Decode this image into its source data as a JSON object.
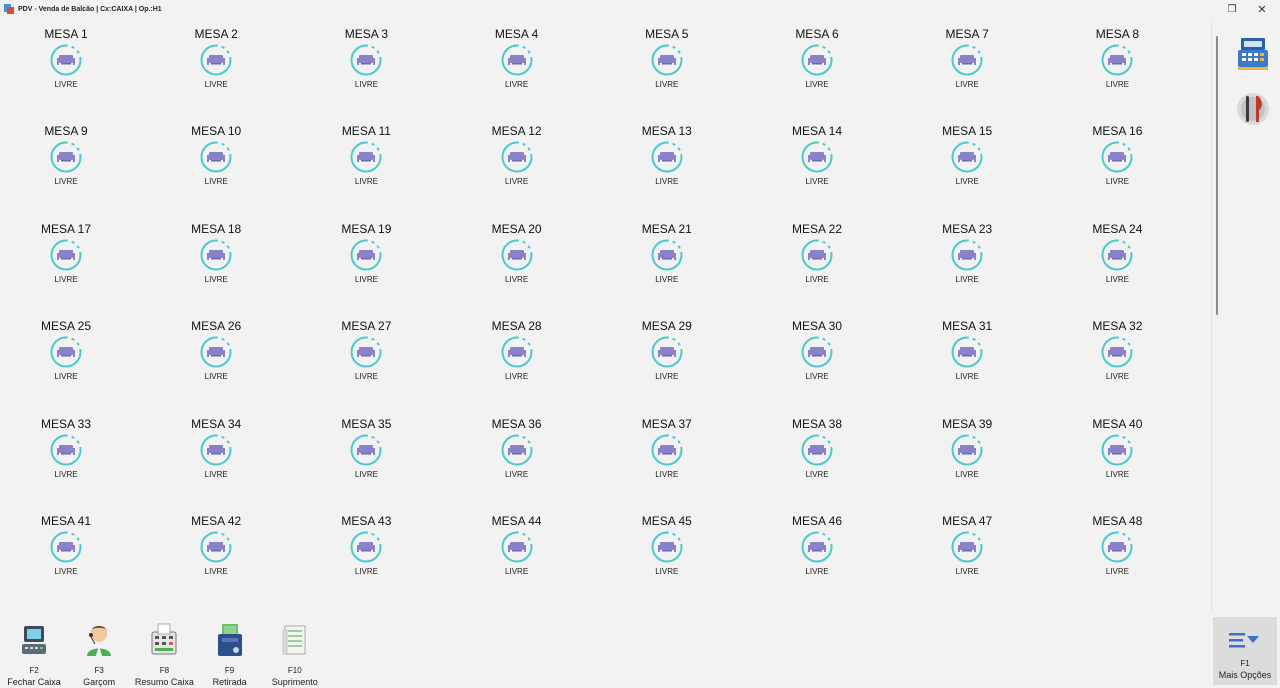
{
  "window": {
    "title": "PDV - Venda de Balcão | Cx:CAIXA | Op.:H1",
    "restore_glyph": "❐",
    "close_glyph": "✕"
  },
  "tables": [
    {
      "name": "MESA 1",
      "status": "LIVRE"
    },
    {
      "name": "MESA 2",
      "status": "LIVRE"
    },
    {
      "name": "MESA 3",
      "status": "LIVRE"
    },
    {
      "name": "MESA 4",
      "status": "LIVRE"
    },
    {
      "name": "MESA 5",
      "status": "LIVRE"
    },
    {
      "name": "MESA 6",
      "status": "LIVRE"
    },
    {
      "name": "MESA 7",
      "status": "LIVRE"
    },
    {
      "name": "MESA 8",
      "status": "LIVRE"
    },
    {
      "name": "MESA 9",
      "status": "LIVRE"
    },
    {
      "name": "MESA 10",
      "status": "LIVRE"
    },
    {
      "name": "MESA 11",
      "status": "LIVRE"
    },
    {
      "name": "MESA 12",
      "status": "LIVRE"
    },
    {
      "name": "MESA 13",
      "status": "LIVRE"
    },
    {
      "name": "MESA 14",
      "status": "LIVRE"
    },
    {
      "name": "MESA 15",
      "status": "LIVRE"
    },
    {
      "name": "MESA 16",
      "status": "LIVRE"
    },
    {
      "name": "MESA 17",
      "status": "LIVRE"
    },
    {
      "name": "MESA 18",
      "status": "LIVRE"
    },
    {
      "name": "MESA 19",
      "status": "LIVRE"
    },
    {
      "name": "MESA 20",
      "status": "LIVRE"
    },
    {
      "name": "MESA 21",
      "status": "LIVRE"
    },
    {
      "name": "MESA 22",
      "status": "LIVRE"
    },
    {
      "name": "MESA 23",
      "status": "LIVRE"
    },
    {
      "name": "MESA 24",
      "status": "LIVRE"
    },
    {
      "name": "MESA 25",
      "status": "LIVRE"
    },
    {
      "name": "MESA 26",
      "status": "LIVRE"
    },
    {
      "name": "MESA 27",
      "status": "LIVRE"
    },
    {
      "name": "MESA 28",
      "status": "LIVRE"
    },
    {
      "name": "MESA 29",
      "status": "LIVRE"
    },
    {
      "name": "MESA 30",
      "status": "LIVRE"
    },
    {
      "name": "MESA 31",
      "status": "LIVRE"
    },
    {
      "name": "MESA 32",
      "status": "LIVRE"
    },
    {
      "name": "MESA 33",
      "status": "LIVRE"
    },
    {
      "name": "MESA 34",
      "status": "LIVRE"
    },
    {
      "name": "MESA 35",
      "status": "LIVRE"
    },
    {
      "name": "MESA 36",
      "status": "LIVRE"
    },
    {
      "name": "MESA 37",
      "status": "LIVRE"
    },
    {
      "name": "MESA 38",
      "status": "LIVRE"
    },
    {
      "name": "MESA 39",
      "status": "LIVRE"
    },
    {
      "name": "MESA 40",
      "status": "LIVRE"
    },
    {
      "name": "MESA 41",
      "status": "LIVRE"
    },
    {
      "name": "MESA 42",
      "status": "LIVRE"
    },
    {
      "name": "MESA 43",
      "status": "LIVRE"
    },
    {
      "name": "MESA 44",
      "status": "LIVRE"
    },
    {
      "name": "MESA 45",
      "status": "LIVRE"
    },
    {
      "name": "MESA 46",
      "status": "LIVRE"
    },
    {
      "name": "MESA 47",
      "status": "LIVRE"
    },
    {
      "name": "MESA 48",
      "status": "LIVRE"
    }
  ],
  "side_buttons": [
    {
      "icon": "cash-register-icon"
    },
    {
      "icon": "restaurant-icon"
    }
  ],
  "function_keys": [
    {
      "key": "F2",
      "label": "Fechar Caixa",
      "icon": "pos-terminal-icon"
    },
    {
      "key": "F3",
      "label": "Garçom",
      "icon": "waiter-icon"
    },
    {
      "key": "F8",
      "label": "Resumo Caixa",
      "icon": "calculator-icon"
    },
    {
      "key": "F9",
      "label": "Retirada",
      "icon": "cash-withdraw-icon"
    },
    {
      "key": "F10",
      "label": "Suprimento",
      "icon": "money-stack-icon"
    }
  ],
  "more_options": {
    "key": "F1",
    "label": "Mais Opções",
    "icon": "menu-dropdown-icon"
  },
  "colors": {
    "ring": "#4cc9cc",
    "table_icon": "#8a82c8",
    "menu_accent": "#3d6fd0"
  }
}
